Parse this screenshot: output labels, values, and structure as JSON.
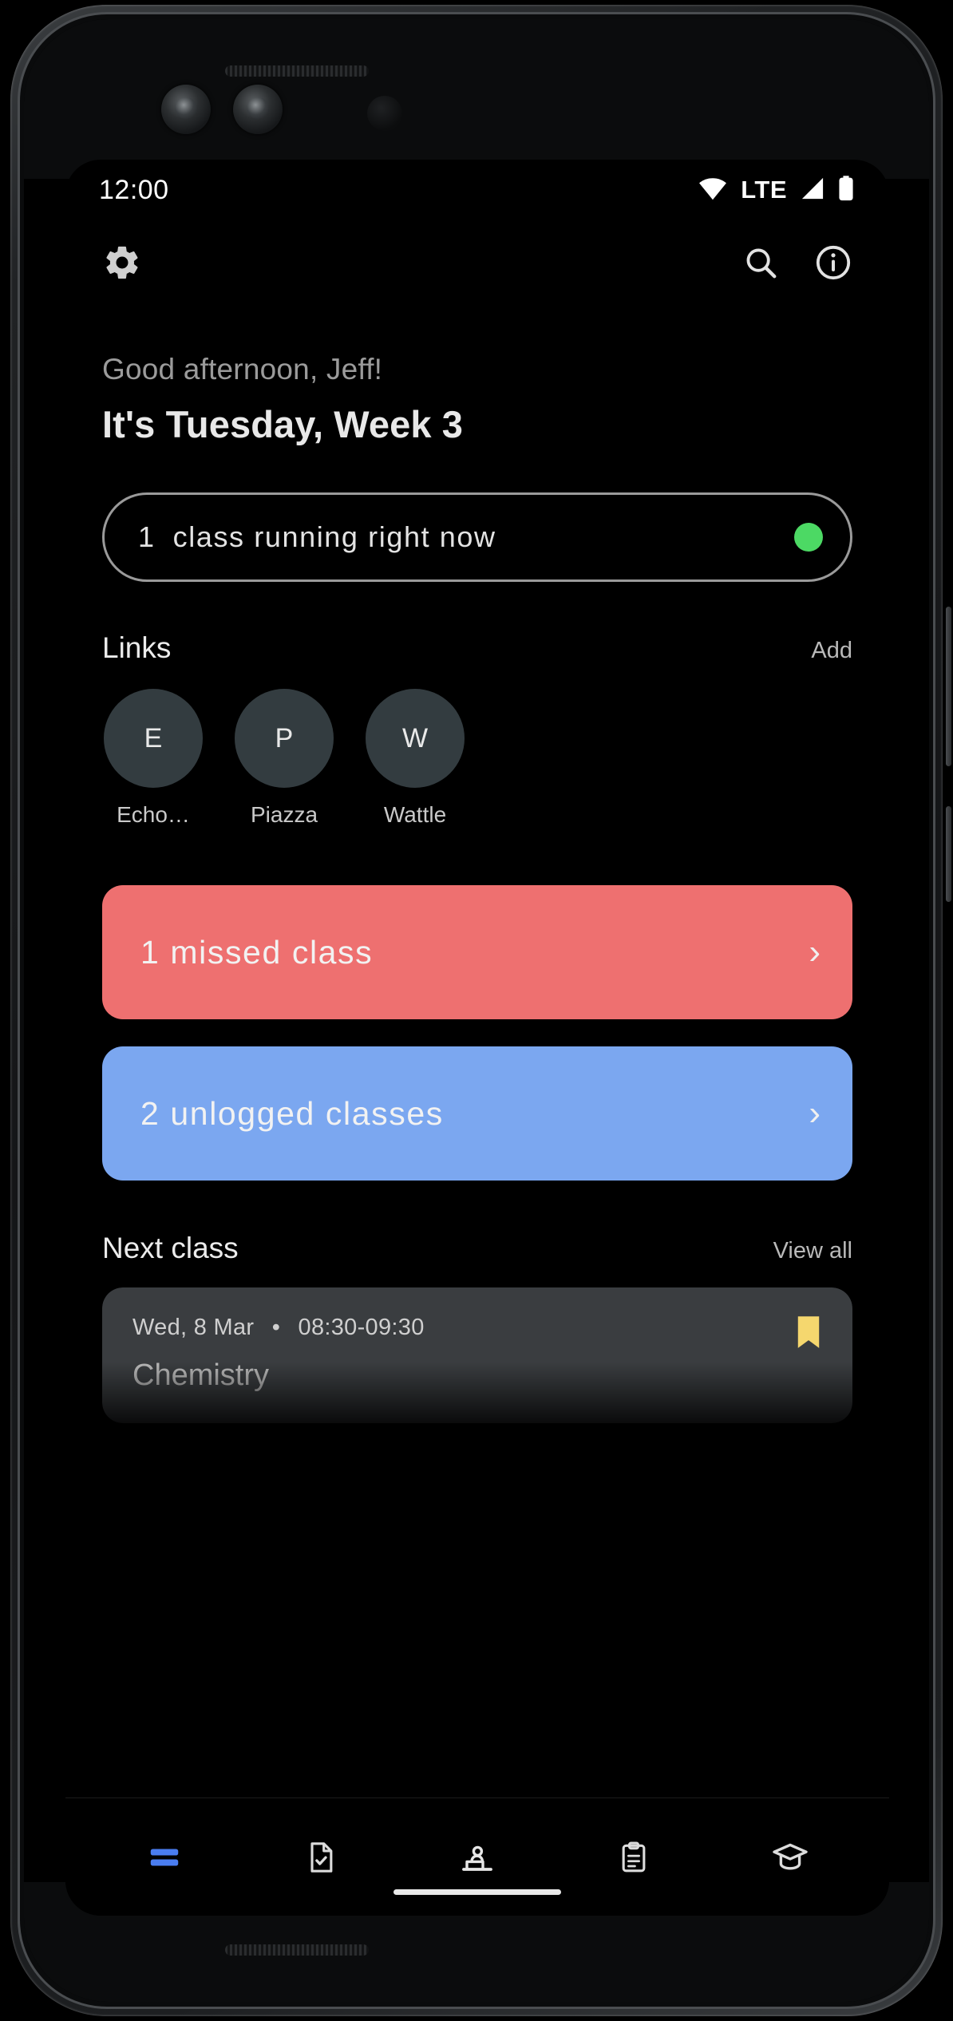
{
  "status_bar": {
    "time": "12:00",
    "network_label": "LTE",
    "icons": [
      "wifi-icon",
      "signal-icon",
      "battery-icon"
    ]
  },
  "toolbar": {
    "settings_icon": "gear-icon",
    "search_icon": "search-icon",
    "info_icon": "info-icon"
  },
  "header": {
    "greeting": "Good afternoon, Jeff!",
    "headline": "It's Tuesday, Week 3"
  },
  "running_pill": {
    "count": "1",
    "label": "class running right now",
    "status_color": "#4CD964"
  },
  "links": {
    "title": "Links",
    "action": "Add",
    "items": [
      {
        "initial": "E",
        "label": "Echo…"
      },
      {
        "initial": "P",
        "label": "Piazza"
      },
      {
        "initial": "W",
        "label": "Wattle"
      }
    ]
  },
  "alerts": [
    {
      "label": "1 missed class",
      "color": "#EE7070",
      "chevron": "›"
    },
    {
      "label": "2 unlogged classes",
      "color": "#7BA7F0",
      "chevron": "›"
    }
  ],
  "next_class": {
    "title": "Next class",
    "action": "View all",
    "card": {
      "date": "Wed, 8 Mar",
      "separator": "•",
      "time": "08:30-09:30",
      "name": "Chemistry",
      "bookmark_icon": "bookmark-icon",
      "bookmark_color": "#F5D76E"
    }
  },
  "bottom_nav": {
    "active_color": "#4A7DF0",
    "items": [
      {
        "name": "dashboard",
        "icon": "dashboard-icon",
        "active": true
      },
      {
        "name": "tasks",
        "icon": "file-check-icon",
        "active": false
      },
      {
        "name": "timetable",
        "icon": "lecture-icon",
        "active": false
      },
      {
        "name": "notes",
        "icon": "clipboard-icon",
        "active": false
      },
      {
        "name": "grades",
        "icon": "graduation-cap-icon",
        "active": false
      }
    ]
  }
}
